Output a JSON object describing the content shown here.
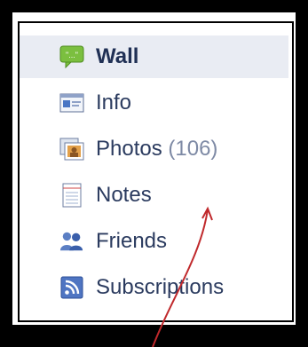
{
  "menu": {
    "items": [
      {
        "label": "Wall",
        "icon": "speech-bubble-icon"
      },
      {
        "label": "Info",
        "icon": "info-card-icon"
      },
      {
        "label": "Photos",
        "count": "(106)",
        "icon": "photos-icon"
      },
      {
        "label": "Notes",
        "icon": "notes-icon"
      },
      {
        "label": "Friends",
        "icon": "friends-icon"
      },
      {
        "label": "Subscriptions",
        "icon": "rss-icon"
      }
    ]
  },
  "colors": {
    "active_bg": "#e9ecf3",
    "text": "#2b3b5f",
    "count": "#7e8aa5",
    "arrow": "#c0292c"
  }
}
